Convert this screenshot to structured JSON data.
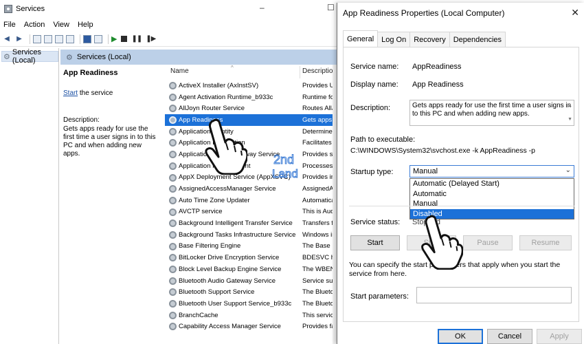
{
  "services_window": {
    "title": "Services",
    "menu": [
      "File",
      "Action",
      "View",
      "Help"
    ],
    "tree_item": "Services (Local)",
    "header_title": "Services (Local)",
    "selected_service": {
      "name": "App Readiness",
      "start_link": "Start",
      "start_suffix": " the service",
      "description_label": "Description:",
      "description": "Gets apps ready for use the first time a user signs in to this PC and when adding new apps."
    },
    "columns": {
      "name": "Name",
      "description": "Description"
    },
    "rows": [
      {
        "name": "ActiveX Installer (AxInstSV)",
        "desc": "Provides Use"
      },
      {
        "name": "Agent Activation Runtime_b933c",
        "desc": "Runtime for"
      },
      {
        "name": "AllJoyn Router Service",
        "desc": "Routes AllJoy"
      },
      {
        "name": "App Readiness",
        "desc": "Gets apps re",
        "selected": true
      },
      {
        "name": "Application Identity",
        "desc": "Determines a"
      },
      {
        "name": "Application Information",
        "desc": "Facilitates th"
      },
      {
        "name": "Application Layer Gateway Service",
        "desc": "Provides sup"
      },
      {
        "name": "Application Management",
        "desc": "Processes ins"
      },
      {
        "name": "AppX Deployment Service (AppXSVC)",
        "desc": "Provides infr"
      },
      {
        "name": "AssignedAccessManager Service",
        "desc": "AssignedAcce"
      },
      {
        "name": "Auto Time Zone Updater",
        "desc": "Automaticall"
      },
      {
        "name": "AVCTP service",
        "desc": "This is Audio"
      },
      {
        "name": "Background Intelligent Transfer Service",
        "desc": "Transfers file"
      },
      {
        "name": "Background Tasks Infrastructure Service",
        "desc": "Windows infr"
      },
      {
        "name": "Base Filtering Engine",
        "desc": "The Base Filt"
      },
      {
        "name": "BitLocker Drive Encryption Service",
        "desc": "BDESVC host"
      },
      {
        "name": "Block Level Backup Engine Service",
        "desc": "The WBENGI"
      },
      {
        "name": "Bluetooth Audio Gateway Service",
        "desc": "Service supp"
      },
      {
        "name": "Bluetooth Support Service",
        "desc": "The Bluetoot"
      },
      {
        "name": "Bluetooth User Support Service_b933c",
        "desc": "The Bluetoot"
      },
      {
        "name": "BranchCache",
        "desc": "This service c"
      },
      {
        "name": "Capability Access Manager Service",
        "desc": "Provides facil"
      }
    ]
  },
  "dialog": {
    "title": "App Readiness Properties (Local Computer)",
    "tabs": [
      "General",
      "Log On",
      "Recovery",
      "Dependencies"
    ],
    "service_name_label": "Service name:",
    "service_name": "AppReadiness",
    "display_name_label": "Display name:",
    "display_name": "App Readiness",
    "description_label": "Description:",
    "description": "Gets apps ready for use the first time a user signs in to this PC and when adding new apps.",
    "path_label": "Path to executable:",
    "path": "C:\\WINDOWS\\System32\\svchost.exe -k AppReadiness -p",
    "startup_type_label": "Startup type:",
    "startup_type_value": "Manual",
    "startup_options": [
      "Automatic (Delayed Start)",
      "Automatic",
      "Manual",
      "Disabled"
    ],
    "highlighted_option": "Disabled",
    "service_status_label": "Service status:",
    "service_status": "Stopped",
    "buttons": {
      "start": "Start",
      "stop": "Stop",
      "pause": "Pause",
      "resume": "Resume"
    },
    "info_text": "You can specify the start parameters that apply when you start the service from here.",
    "start_params_label": "Start parameters:",
    "footer": {
      "ok": "OK",
      "cancel": "Cancel",
      "apply": "Apply"
    }
  },
  "watermark": {
    "line1": "2nd",
    "line2": "Land"
  },
  "colors": {
    "selection": "#1c71d8",
    "header": "#bcd0e8",
    "watermark": "#3a7bd5"
  }
}
